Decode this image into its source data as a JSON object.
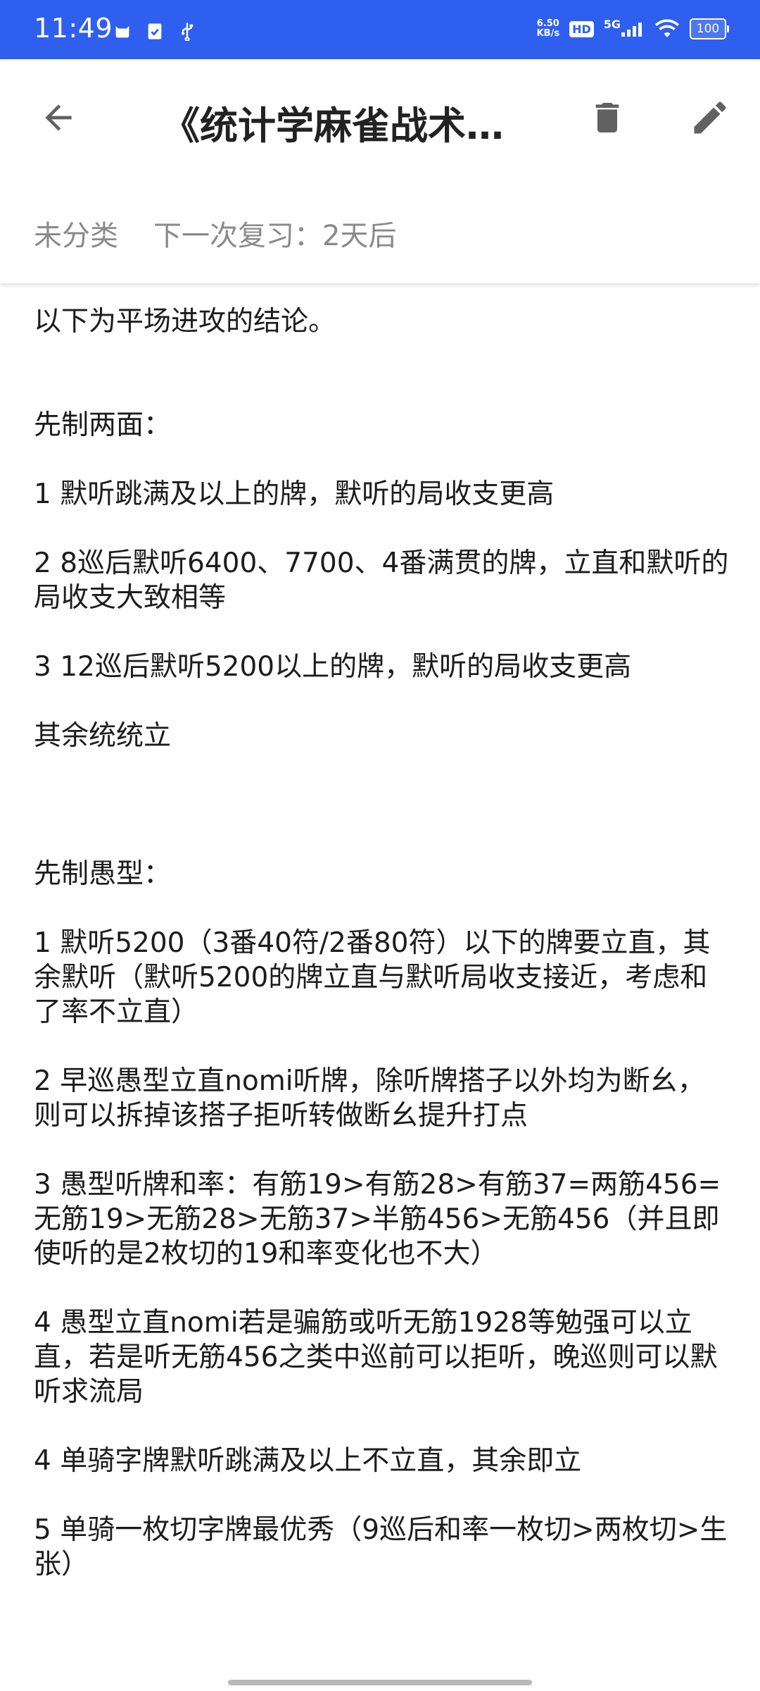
{
  "status_bar": {
    "time": "11:49",
    "net_speed_value": "6.50",
    "net_speed_unit": "KB/s",
    "hd_label": "HD",
    "network_label": "5G",
    "battery": "100",
    "background_color": "#2f5fef"
  },
  "header": {
    "title": "《统计学麻雀战术…",
    "back_icon": "arrow-left-icon",
    "delete_icon": "trash-icon",
    "edit_icon": "pencil-icon",
    "category": "未分类",
    "next_review": "下一次复习：2天后"
  },
  "content": {
    "intro": "以下为平场进攻的结论。",
    "section1": {
      "heading": "先制两面：",
      "items": [
        "1 默听跳满及以上的牌，默听的局收支更高",
        "2 8巡后默听6400、7700、4番满贯的牌，立直和默听的局收支大致相等",
        "3 12巡后默听5200以上的牌，默听的局收支更高"
      ],
      "footer": "其余统统立"
    },
    "section2": {
      "heading": "先制愚型：",
      "items": [
        "1 默听5200（3番40符/2番80符）以下的牌要立直，其余默听（默听5200的牌立直与默听局收支接近，考虑和了率不立直）",
        "2 早巡愚型立直nomi听牌，除听牌搭子以外均为断幺，则可以拆掉该搭子拒听转做断幺提升打点",
        "3 愚型听牌和率：有筋19>有筋28>有筋37=两筋456=无筋19>无筋28>无筋37>半筋456>无筋456（并且即使听的是2枚切的19和率变化也不大）",
        "4 愚型立直nomi若是骗筋或听无筋1928等勉强可以立直，若是听无筋456之类中巡前可以拒听，晚巡则可以默听求流局",
        "4 单骑字牌默听跳满及以上不立直，其余即立",
        "5 单骑一枚切字牌最优秀（9巡后和率一枚切>两枚切>生张）"
      ]
    }
  }
}
